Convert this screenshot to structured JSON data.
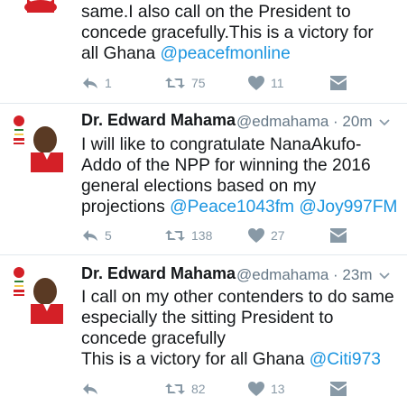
{
  "tweets": [
    {
      "name": "",
      "handle": "",
      "time": "",
      "lines": [
        {
          "parts": [
            {
              "text": "same.I also call on the President to",
              "mention": false
            }
          ]
        },
        {
          "parts": [
            {
              "text": "concede gracefully.This is a victory for",
              "mention": false
            }
          ]
        },
        {
          "parts": [
            {
              "text": "all Ghana ",
              "mention": false
            },
            {
              "text": "@peacefmonline",
              "mention": true
            }
          ]
        }
      ],
      "reply_count": "1",
      "retweet_count": "75",
      "like_count": "11"
    },
    {
      "name": "Dr. Edward Mahama",
      "handle": "@edmahama",
      "time": "· 20m",
      "lines": [
        {
          "parts": [
            {
              "text": "I will like to congratulate NanaAkufo-",
              "mention": false
            }
          ]
        },
        {
          "parts": [
            {
              "text": "Addo of the NPP for winning the 2016",
              "mention": false
            }
          ]
        },
        {
          "parts": [
            {
              "text": "general elections based on my",
              "mention": false
            }
          ]
        },
        {
          "parts": [
            {
              "text": "projections ",
              "mention": false
            },
            {
              "text": "@Peace1043fm",
              "mention": true
            },
            {
              "text": " ",
              "mention": false
            },
            {
              "text": "@Joy997FM",
              "mention": true
            }
          ]
        }
      ],
      "reply_count": "5",
      "retweet_count": "138",
      "like_count": "27"
    },
    {
      "name": "Dr. Edward Mahama",
      "handle": "@edmahama",
      "time": "· 23m",
      "lines": [
        {
          "parts": [
            {
              "text": "I call on my other contenders to do same",
              "mention": false
            }
          ]
        },
        {
          "parts": [
            {
              "text": "especially the sitting President to",
              "mention": false
            }
          ]
        },
        {
          "parts": [
            {
              "text": "concede gracefully",
              "mention": false
            }
          ]
        },
        {
          "parts": [
            {
              "text": "This is a victory for all Ghana ",
              "mention": false
            },
            {
              "text": "@Citi973",
              "mention": true
            }
          ]
        }
      ],
      "reply_count": "",
      "retweet_count": "82",
      "like_count": "13"
    }
  ],
  "icons": {
    "reply": "reply-icon",
    "retweet": "retweet-icon",
    "like": "heart-icon",
    "dm": "envelope-icon",
    "caret": "chevron-down-icon"
  },
  "colors": {
    "mention": "#1b95e0",
    "action_gray": "#8899a6",
    "border": "#e1e8ed",
    "avatar_red": "#d42027"
  }
}
